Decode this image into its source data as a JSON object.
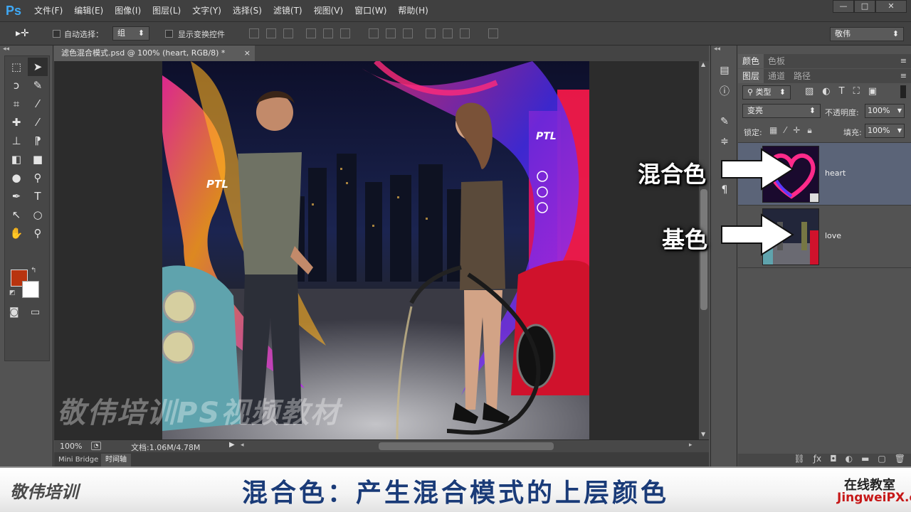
{
  "app": {
    "logo": "Ps"
  },
  "menu": [
    "文件(F)",
    "编辑(E)",
    "图像(I)",
    "图层(L)",
    "文字(Y)",
    "选择(S)",
    "滤镜(T)",
    "视图(V)",
    "窗口(W)",
    "帮助(H)"
  ],
  "window_controls": {
    "minimize": "—",
    "restore": "□",
    "close": "✕"
  },
  "options": {
    "auto_select_label": "自动选择：",
    "auto_select_value": "组",
    "show_transform_label": "显示变换控件",
    "workspace": "敬伟"
  },
  "document": {
    "tab_title": "滤色混合模式.psd @ 100% (heart, RGB/8) *",
    "zoom": "100%",
    "doc_size": "文档:1.06M/4.78M",
    "watermark": "敬伟培训PS视频教材"
  },
  "bottom_tabs": [
    "Mini Bridge",
    "时间轴"
  ],
  "panels": {
    "top_tabs": [
      "颜色",
      "色板"
    ],
    "layer_tabs": [
      "图层",
      "通道",
      "路径"
    ],
    "filter_kind": "类型",
    "blend_mode": "变亮",
    "opacity_label": "不透明度:",
    "opacity_value": "100%",
    "lock_label": "锁定:",
    "fill_label": "填充:",
    "fill_value": "100%",
    "layers": [
      {
        "name": "heart",
        "selected": true
      },
      {
        "name": "love",
        "selected": false
      }
    ]
  },
  "annotations": {
    "blend_color": "混合色",
    "base_color": "基色"
  },
  "caption": {
    "text": "混合色：产生混合模式的上层颜色",
    "left_logo": "敬伟培训",
    "right_line1": "在线教室",
    "right_line2": "JingweiPX.com"
  },
  "colors": {
    "foreground": "#b8340f",
    "background": "#ffffff",
    "accent": "#1a3b78"
  }
}
